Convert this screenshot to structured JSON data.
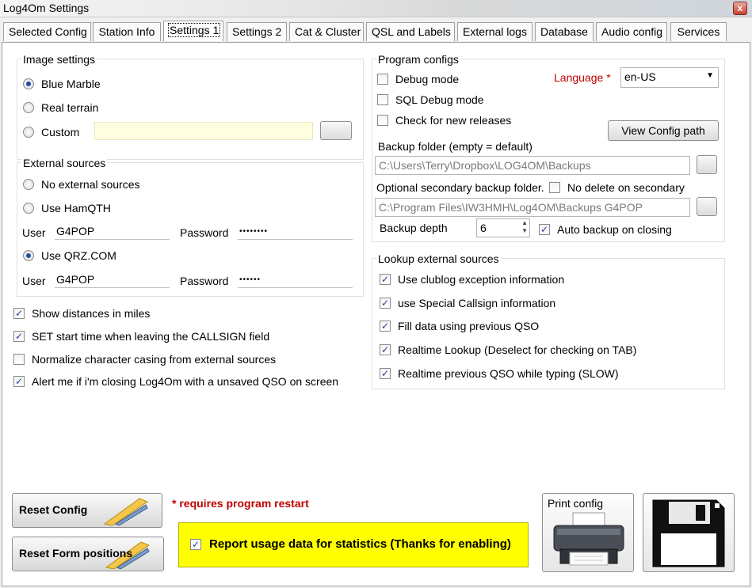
{
  "window": {
    "title": "Log4Om Settings",
    "close_label": "x"
  },
  "tabs": [
    "Selected Config",
    "Station Info",
    "Settings 1",
    "Settings 2",
    "Cat & Cluster",
    "QSL and Labels",
    "External logs",
    "Database",
    "Audio config",
    "Services"
  ],
  "image_settings": {
    "label": "Image settings",
    "options": [
      "Blue Marble",
      "Real terrain",
      "Custom"
    ],
    "selected": "Blue Marble",
    "custom_value": "",
    "browse_label": ""
  },
  "external_sources": {
    "label": "External sources",
    "opt_none": "No external sources",
    "opt_hamqth": "Use HamQTH",
    "opt_qrz": "Use QRZ.COM",
    "selected": "Use QRZ.COM",
    "user_label": "User",
    "password_label": "Password",
    "hamqth_user": "G4POP",
    "hamqth_password": "••••••••",
    "qrz_user": "G4POP",
    "qrz_password": "••••••"
  },
  "options": {
    "show_distances": {
      "label": "Show distances in miles",
      "checked": true
    },
    "set_start_time": {
      "label": "SET start time when leaving the CALLSIGN field",
      "checked": true
    },
    "normalize_casing": {
      "label": "Normalize character casing from external sources",
      "checked": false
    },
    "alert_unsaved": {
      "label": "Alert me if i'm closing Log4Om with a unsaved QSO on screen",
      "checked": true
    }
  },
  "program_configs": {
    "label": "Program configs",
    "debug_mode": {
      "label": "Debug mode",
      "checked": false
    },
    "sql_debug": {
      "label": "SQL Debug mode",
      "checked": false
    },
    "check_releases": {
      "label": "Check for new releases",
      "checked": false
    },
    "language_label": "Language",
    "language_star": "*",
    "language_value": "en-US",
    "view_config_path": "View Config path",
    "backup_folder_label": "Backup folder (empty = default)",
    "backup_folder": "C:\\Users\\Terry\\Dropbox\\LOG4OM\\Backups",
    "secondary_label": "Optional secondary backup folder.",
    "no_delete_secondary": {
      "label": "No delete on secondary",
      "checked": false
    },
    "secondary_folder": "C:\\Program Files\\IW3HMH\\Log4OM\\Backups G4POP",
    "backup_depth_label": "Backup depth",
    "backup_depth": "6",
    "auto_backup": {
      "label": "Auto backup on closing",
      "checked": true
    }
  },
  "lookup": {
    "label": "Lookup external sources",
    "items": [
      {
        "label": "Use clublog exception information",
        "checked": true
      },
      {
        "label": "use Special Callsign information",
        "checked": true
      },
      {
        "label": "Fill data using previous QSO",
        "checked": true
      },
      {
        "label": "Realtime Lookup (Deselect for checking on TAB)",
        "checked": true
      },
      {
        "label": "Realtime previous QSO while typing (SLOW)",
        "checked": true
      }
    ]
  },
  "footer": {
    "reset_config": "Reset Config",
    "reset_form": "Reset Form positions",
    "restart_note_star": "*",
    "restart_note": "requires program restart",
    "usage_data": {
      "label": "Report usage data for statistics (Thanks for enabling)",
      "checked": true
    },
    "print_config": "Print config"
  },
  "colors": {
    "accent_red": "#c00000",
    "usage_bg": "#ffff00",
    "field_yellow": "#ffffe0"
  },
  "icons": {
    "printer": "printer-icon",
    "floppy": "floppy-disk-icon",
    "tools": "wrench-screwdriver-icon"
  }
}
